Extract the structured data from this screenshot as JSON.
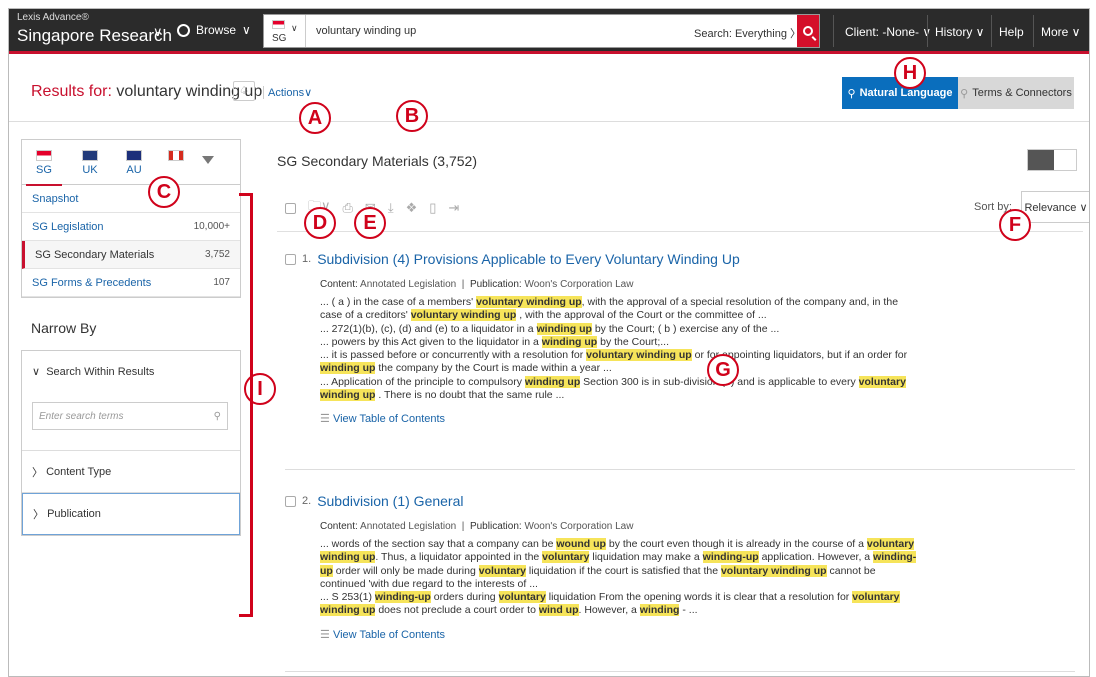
{
  "topbar": {
    "brand_line1": "Lexis Advance®",
    "brand_line2": "Singapore Research",
    "browse": "Browse",
    "search_jurisdiction": "SG",
    "search_query": "voluntary winding up",
    "search_scope": "Search: Everything  〉",
    "client": "Client: -None-  ∨",
    "history": "History  ∨",
    "help": "Help",
    "more": "More  ∨"
  },
  "header": {
    "results_for": "Results for: ",
    "query": "voluntary winding up",
    "actions": "Actions∨",
    "natural_language": "Natural Language",
    "terms_connectors": "Terms & Connectors"
  },
  "sidebar": {
    "jurisdictions": [
      "SG",
      "UK",
      "AU",
      ""
    ],
    "categories": [
      {
        "label": "Snapshot",
        "count": ""
      },
      {
        "label": "SG Legislation",
        "count": "10,000+"
      },
      {
        "label": "SG Secondary Materials",
        "count": "3,752"
      },
      {
        "label": "SG Forms & Precedents",
        "count": "107"
      }
    ],
    "narrow_by": "Narrow By",
    "search_within": "Search Within Results",
    "search_within_placeholder": "Enter search terms",
    "content_type": "Content Type",
    "publication": "Publication"
  },
  "main": {
    "section_title": "SG Secondary Materials (3,752)",
    "sort_by": "Sort by:",
    "sort_value": "Relevance  ∨",
    "view_toc": "View Table of Contents"
  },
  "results": [
    {
      "num": "1.",
      "title": "Subdivision (4) Provisions Applicable to Every Voluntary Winding Up",
      "content_label": "Content:",
      "content": "Annotated Legislation",
      "publication_label": "Publication:",
      "publication": "Woon's Corporation Law"
    },
    {
      "num": "2.",
      "title": "Subdivision (1) General",
      "content_label": "Content:",
      "content": "Annotated Legislation",
      "publication_label": "Publication:",
      "publication": "Woon's Corporation Law"
    }
  ],
  "callouts": [
    "A",
    "B",
    "C",
    "D",
    "E",
    "F",
    "G",
    "H",
    "I"
  ],
  "colors": {
    "accent_red": "#c8102e",
    "link_blue": "#1a64a8",
    "nl_blue": "#0a6ebd",
    "highlight": "#f6e45a"
  }
}
